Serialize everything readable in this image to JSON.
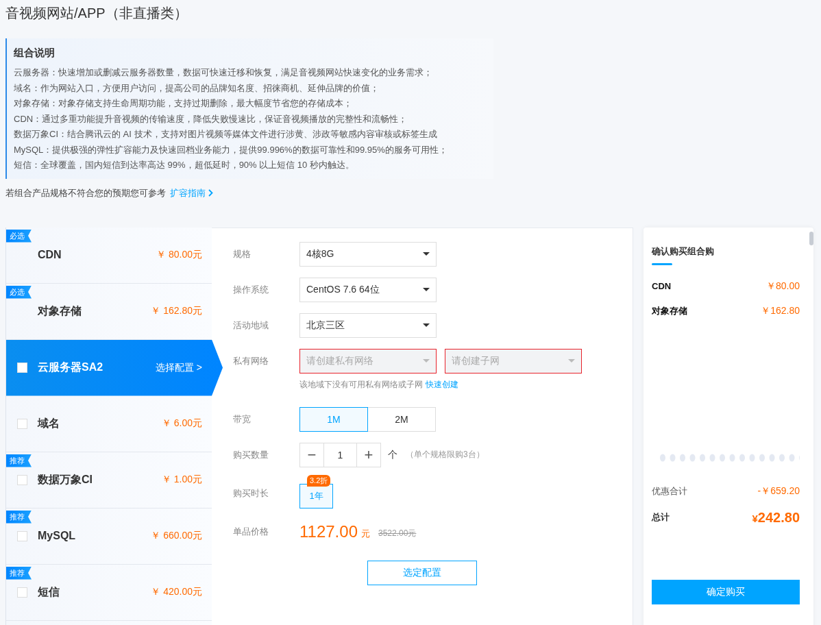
{
  "page_title": "音视频网站/APP（非直播类）",
  "description": {
    "title": "组合说明",
    "lines": [
      "云服务器：快速增加或删减云服务器数量，数据可快速迁移和恢复，满足音视频网站快速变化的业务需求；",
      "域名：作为网站入口，方便用户访问，提高公司的品牌知名度、招徕商机、延伸品牌的价值；",
      "对象存储：对象存储支持生命周期功能，支持过期删除，最大幅度节省您的存储成本；",
      "CDN：通过多重功能提升音视频的传输速度，降低失败慢速比，保证音视频播放的完整性和流畅性；",
      "数据万象CI：结合腾讯云的 AI 技术，支持对图片视频等媒体文件进行涉黄、涉政等敏感内容审核或标签生成",
      "MySQL：提供极强的弹性扩容能力及快速回档业务能力，提供99.996%的数据可靠性和99.95%的服务可用性；",
      "短信：全球覆盖，国内短信到达率高达 99%，超低延时，90% 以上短信 10 秒内触达。"
    ]
  },
  "guide": {
    "text": "若组合产品规格不符合您的预期您可参考",
    "link": "扩容指南"
  },
  "products": [
    {
      "kind": "required",
      "tag": "必选",
      "name": "CDN",
      "price": "￥ 80.00元",
      "selected": false
    },
    {
      "kind": "required",
      "tag": "必选",
      "name": "对象存储",
      "price": "￥ 162.80元",
      "selected": false
    },
    {
      "kind": "optional",
      "name": "云服务器SA2",
      "action": "选择配置 >",
      "checked": false,
      "selected": true
    },
    {
      "kind": "optional",
      "name": "域名",
      "price": "￥ 6.00元",
      "checked": false,
      "selected": false
    },
    {
      "kind": "optional",
      "tag": "推荐",
      "name": "数据万象CI",
      "price": "￥ 1.00元",
      "checked": false,
      "selected": false
    },
    {
      "kind": "optional",
      "tag": "推荐",
      "name": "MySQL",
      "price": "￥ 660.00元",
      "checked": false,
      "selected": false
    },
    {
      "kind": "optional",
      "tag": "推荐",
      "name": "短信",
      "price": "￥ 420.00元",
      "checked": false,
      "selected": false
    }
  ],
  "config": {
    "selects": [
      {
        "label": "规格",
        "value": "4核8G"
      },
      {
        "label": "操作系统",
        "value": "CentOS 7.6 64位"
      },
      {
        "label": "活动地域",
        "value": "北京三区"
      }
    ],
    "vpc": {
      "label": "私有网络",
      "fields": [
        {
          "placeholder": "请创建私有网络",
          "error": true
        },
        {
          "placeholder": "请创建子网",
          "error": true
        }
      ],
      "hint": "该地域下没有可用私有网络或子网",
      "link": "快速创建"
    },
    "bandwidth": {
      "label": "带宽",
      "options": [
        {
          "label": "1M",
          "selected": true
        },
        {
          "label": "2M",
          "selected": false
        }
      ]
    },
    "quantity": {
      "label": "购买数量",
      "minus": "−",
      "value": "1",
      "plus": "+",
      "unit": "个",
      "note": "（单个规格限购3台）"
    },
    "duration": {
      "label": "购买时长",
      "options": [
        {
          "label": "1年",
          "badge": "3.2折",
          "selected": true
        }
      ]
    },
    "price": {
      "label": "单品价格",
      "value": "1127.00",
      "unit": "元",
      "original": "3522.00元"
    },
    "button": "选定配置"
  },
  "summary": {
    "title": "确认购买组合购",
    "items": [
      {
        "name": "CDN",
        "price": "￥80.00"
      },
      {
        "name": "对象存储",
        "price": "￥162.80"
      }
    ],
    "discount": {
      "label": "优惠合计",
      "value": "-￥659.20"
    },
    "total": {
      "label": "总计",
      "currency": "¥",
      "amount": "242.80"
    },
    "button": "确定购买"
  }
}
